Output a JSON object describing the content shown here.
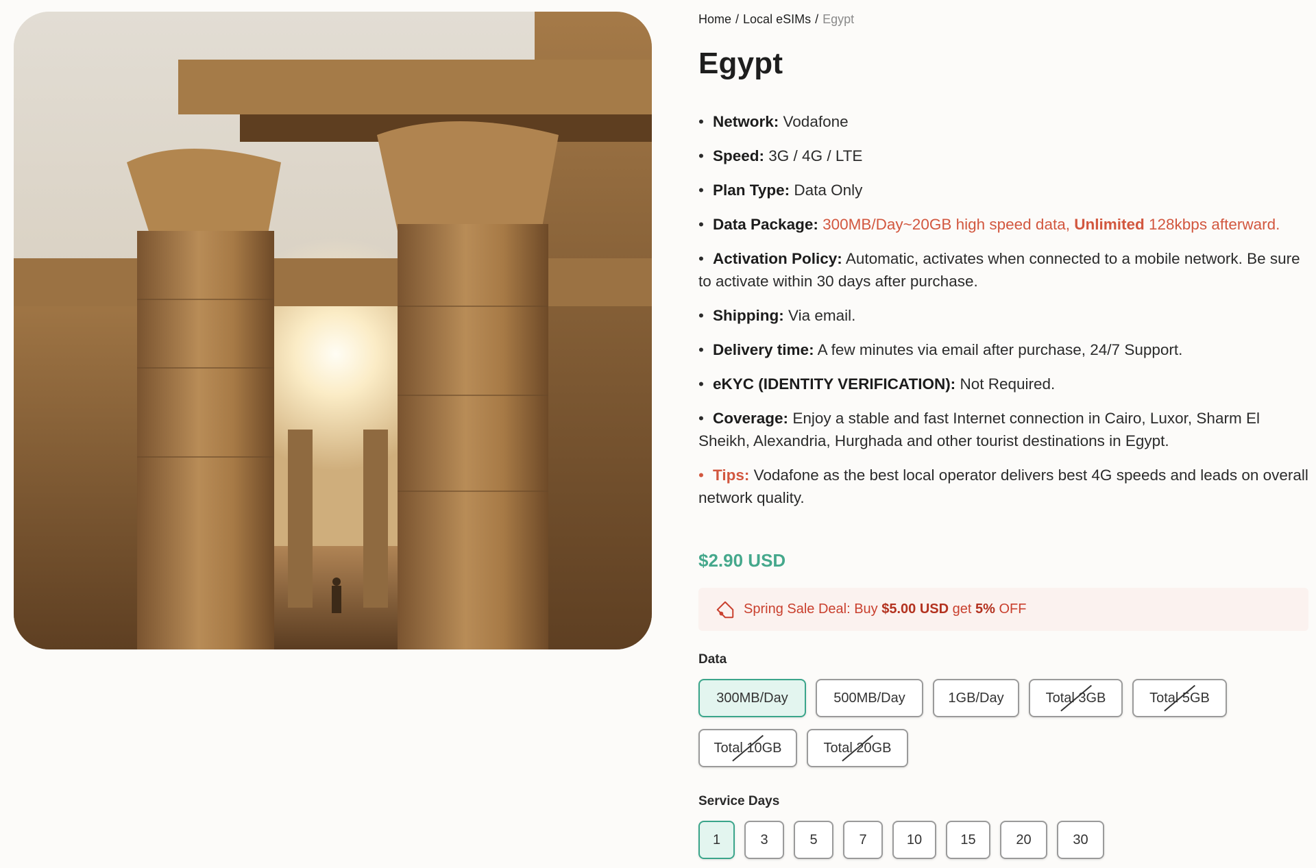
{
  "breadcrumb": {
    "home": "Home",
    "section": "Local eSIMs",
    "current": "Egypt",
    "separator": "/"
  },
  "product": {
    "title": "Egypt",
    "specs": [
      {
        "label": "Network:",
        "value": "Vodafone"
      },
      {
        "label": "Speed:",
        "value": "3G / 4G / LTE"
      },
      {
        "label": "Plan Type:",
        "value": "Data Only"
      },
      {
        "label": "Data Package:",
        "value_before": "300MB/Day~20GB high speed data, ",
        "value_bold": "Unlimited",
        "value_after": " 128kbps afterward."
      },
      {
        "label": "Activation Policy:",
        "value": "Automatic, activates when connected to a mobile network. Be sure to activate within 30 days after purchase."
      },
      {
        "label": "Shipping:",
        "value": "Via email."
      },
      {
        "label": "Delivery time:",
        "value": "A few minutes via email after purchase, 24/7 Support."
      },
      {
        "label": "eKYC (IDENTITY VERIFICATION):",
        "value": "Not Required."
      },
      {
        "label": "Coverage:",
        "value": "Enjoy a stable and fast Internet connection in Cairo, Luxor, Sharm El Sheikh, Alexandria, Hurghada and other tourist destinations in Egypt."
      },
      {
        "label": "Tips:",
        "value": "Vodafone as the best local operator delivers best 4G speeds and leads on overall network quality."
      }
    ],
    "bullet": "•",
    "price": "$2.90 USD"
  },
  "deal": {
    "prefix": "Spring Sale Deal: Buy ",
    "amount": "$5.00 USD",
    "middle": " get ",
    "percent": "5%",
    "suffix": " OFF",
    "icon": "tag-icon"
  },
  "data_options": {
    "label": "Data",
    "items": [
      {
        "label": "300MB/Day",
        "selected": true,
        "unavailable": false
      },
      {
        "label": "500MB/Day",
        "selected": false,
        "unavailable": false
      },
      {
        "label": "1GB/Day",
        "selected": false,
        "unavailable": false
      },
      {
        "label": "Total 3GB",
        "selected": false,
        "unavailable": true
      },
      {
        "label": "Total 5GB",
        "selected": false,
        "unavailable": true
      },
      {
        "label": "Total 10GB",
        "selected": false,
        "unavailable": true
      },
      {
        "label": "Total 20GB",
        "selected": false,
        "unavailable": true
      }
    ]
  },
  "day_options": {
    "label": "Service Days",
    "items": [
      {
        "label": "1",
        "selected": true
      },
      {
        "label": "3",
        "selected": false
      },
      {
        "label": "5",
        "selected": false
      },
      {
        "label": "7",
        "selected": false
      },
      {
        "label": "10",
        "selected": false
      },
      {
        "label": "15",
        "selected": false
      },
      {
        "label": "20",
        "selected": false
      },
      {
        "label": "30",
        "selected": false
      }
    ]
  },
  "colors": {
    "accent_green": "#45a88c",
    "selected_border": "#3aa58a",
    "selected_fill": "#e3f5ef",
    "highlight_red": "#d2573f",
    "deal_background": "#fbf2ef"
  }
}
